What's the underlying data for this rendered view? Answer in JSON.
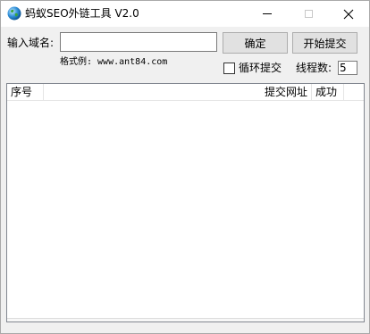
{
  "window": {
    "title": "蚂蚁SEO外链工具 V2.0",
    "icons": {
      "app": "globe-icon",
      "minimize": "minimize-icon",
      "maximize": "maximize-icon",
      "close": "close-icon"
    }
  },
  "form": {
    "domain_label": "输入域名:",
    "domain_value": "",
    "format_hint": "格式例: www.ant84.com",
    "confirm_label": "确定",
    "start_label": "开始提交",
    "loop_label": "循环提交",
    "loop_checked": false,
    "threads_label": "线程数:",
    "threads_value": "5"
  },
  "list": {
    "columns": [
      "序号",
      "提交网址",
      "成功"
    ],
    "rows": []
  },
  "colors": {
    "window_bg": "#f0f0f0",
    "button_bg": "#e1e1e1",
    "list_bg": "#ffffff"
  }
}
